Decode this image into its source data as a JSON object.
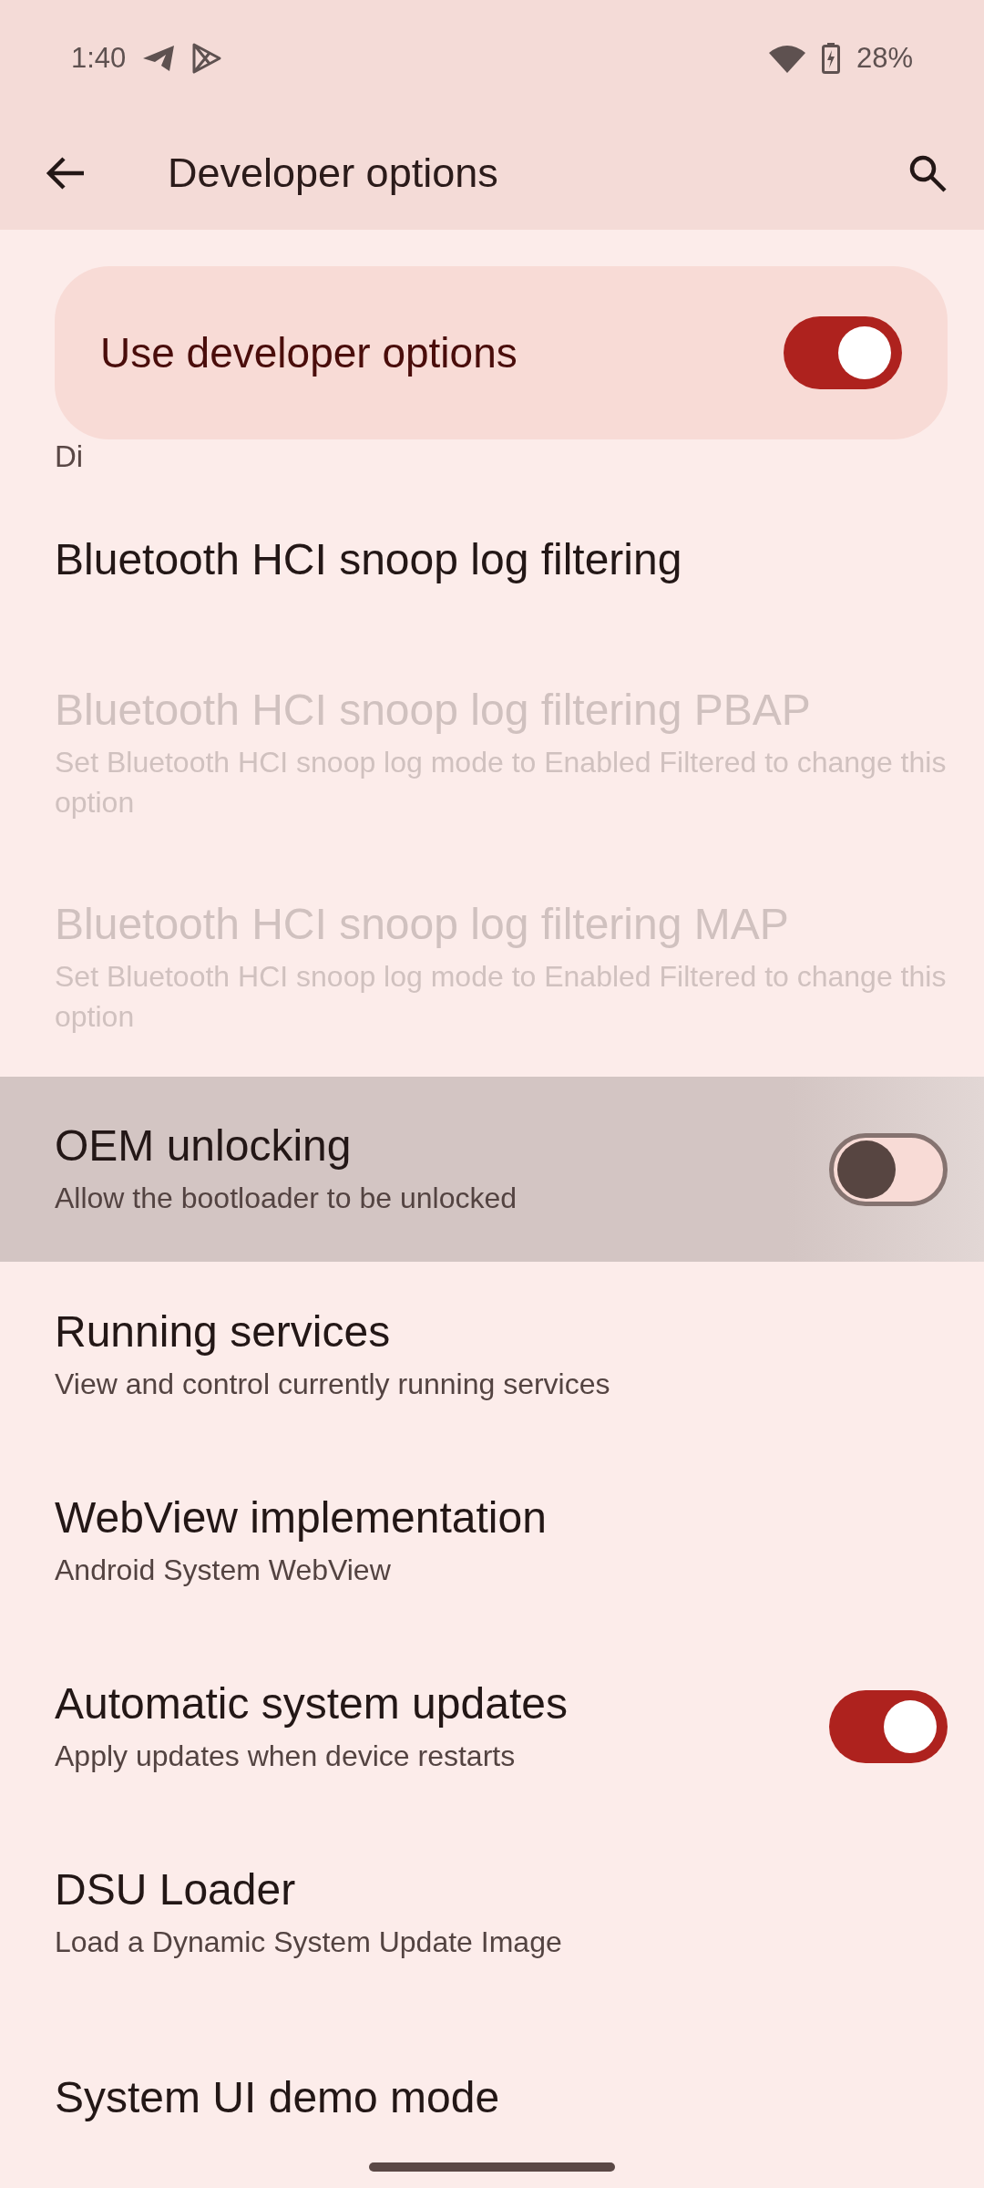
{
  "status_bar": {
    "time": "1:40",
    "battery": "28%"
  },
  "app_bar": {
    "title": "Developer options"
  },
  "master_switch": {
    "label": "Use developer options",
    "on": true
  },
  "partial_item": {
    "title": "Di"
  },
  "items": [
    {
      "kind": "plain",
      "title": "Bluetooth HCI snoop log filtering",
      "disabled": false,
      "highlighted": false
    },
    {
      "kind": "plain",
      "title": "Bluetooth HCI snoop log filtering PBAP",
      "subtitle": "Set Bluetooth HCI snoop log mode to Enabled Filtered to change this option",
      "disabled": true,
      "highlighted": false
    },
    {
      "kind": "plain",
      "title": "Bluetooth HCI snoop log filtering MAP",
      "subtitle": "Set Bluetooth HCI snoop log mode to Enabled Filtered to change this option",
      "disabled": true,
      "highlighted": false
    },
    {
      "kind": "toggle",
      "title": "OEM unlocking",
      "subtitle": "Allow the bootloader to be unlocked",
      "on": false,
      "disabled": false,
      "highlighted": true
    },
    {
      "kind": "plain",
      "title": "Running services",
      "subtitle": "View and control currently running services",
      "disabled": false,
      "highlighted": false
    },
    {
      "kind": "plain",
      "title": "WebView implementation",
      "subtitle": "Android System WebView",
      "disabled": false,
      "highlighted": false
    },
    {
      "kind": "toggle",
      "title": "Automatic system updates",
      "subtitle": "Apply updates when device restarts",
      "on": true,
      "disabled": false,
      "highlighted": false
    },
    {
      "kind": "plain",
      "title": "DSU Loader",
      "subtitle": "Load a Dynamic System Update Image",
      "disabled": false,
      "highlighted": false
    },
    {
      "kind": "plain",
      "title": "System UI demo mode",
      "disabled": false,
      "highlighted": false
    }
  ]
}
